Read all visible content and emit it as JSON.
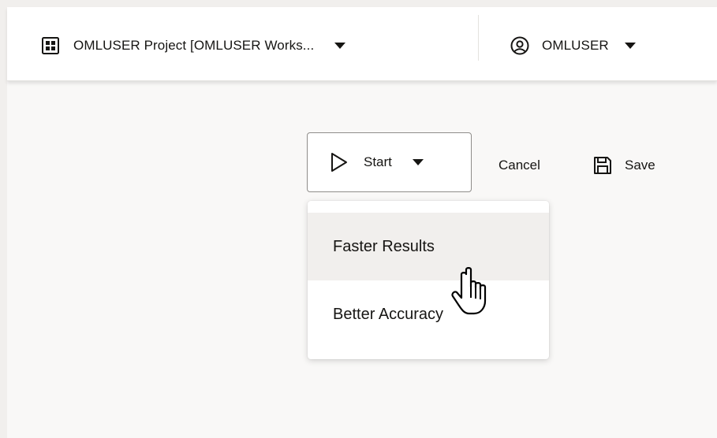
{
  "header": {
    "project_label": "OMLUSER Project [OMLUSER Works...",
    "project_icon": "grid-icon",
    "user_label": "OMLUSER",
    "user_icon": "user-circle-icon",
    "caret_icon": "caret-down-icon"
  },
  "toolbar": {
    "start_label": "Start",
    "start_icon": "play-icon",
    "cancel_label": "Cancel",
    "save_label": "Save",
    "save_icon": "save-icon"
  },
  "start_menu": {
    "items": [
      {
        "label": "Faster Results",
        "highlighted": true
      },
      {
        "label": "Better Accuracy",
        "highlighted": false
      }
    ]
  },
  "cursor": {
    "type": "hand-pointer-icon"
  },
  "colors": {
    "text": "#161513",
    "border": "#8f8d8a",
    "highlight": "#f1efed",
    "background": "#f9f8f7"
  }
}
